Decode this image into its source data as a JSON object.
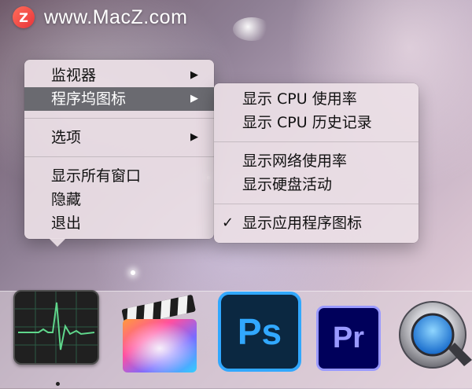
{
  "watermark": {
    "logo_letter": "Z",
    "text": "www.MacZ.com"
  },
  "main_menu": {
    "items": [
      {
        "label": "监视器",
        "has_submenu": true
      },
      {
        "label": "程序坞图标",
        "has_submenu": true,
        "highlighted": true
      },
      {
        "label": "选项",
        "has_submenu": true
      },
      {
        "label": "显示所有窗口"
      },
      {
        "label": "隐藏"
      },
      {
        "label": "退出"
      }
    ],
    "submenu_arrow": "▶"
  },
  "dock_icon_submenu": {
    "items": [
      {
        "label": "显示 CPU 使用率"
      },
      {
        "label": "显示 CPU 历史记录"
      },
      {
        "label": "显示网络使用率"
      },
      {
        "label": "显示硬盘活动"
      },
      {
        "label": "显示应用程序图标",
        "checked": true
      }
    ],
    "check_mark": "✓"
  },
  "dock": {
    "apps": [
      {
        "name": "Activity Monitor",
        "icon": "activity-monitor-icon",
        "running": true
      },
      {
        "name": "Final Cut Pro",
        "icon": "final-cut-pro-icon"
      },
      {
        "name": "Photoshop",
        "icon": "photoshop-icon",
        "label": "Ps"
      },
      {
        "name": "Premiere Pro",
        "icon": "premiere-pro-icon",
        "label": "Pr"
      },
      {
        "name": "QuickTime Player",
        "icon": "quicktime-icon"
      }
    ]
  },
  "colors": {
    "menu_highlight": "#6a6a70",
    "photoshop_accent": "#31a8ff",
    "premiere_accent": "#9999ff"
  }
}
